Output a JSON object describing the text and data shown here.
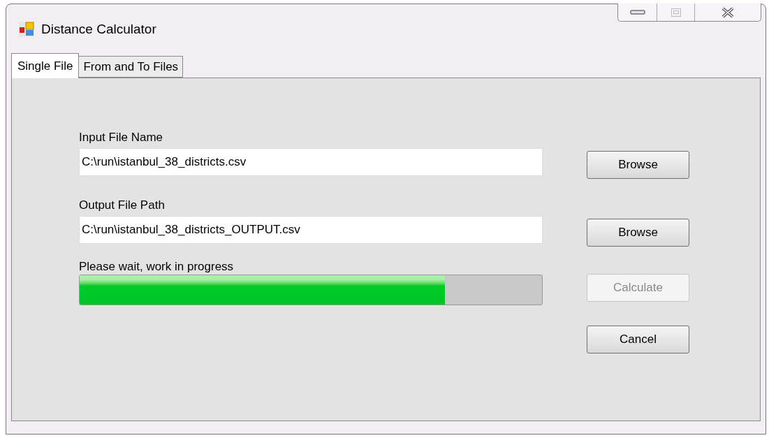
{
  "window": {
    "title": "Distance Calculator"
  },
  "tabs": [
    {
      "label": "Single File",
      "selected": true
    },
    {
      "label": "From and To Files",
      "selected": false
    }
  ],
  "fields": [
    {
      "label": "Input File Name",
      "value": "C:\\run\\istanbul_38_districts.csv",
      "button": {
        "label": "Browse",
        "disabled": false
      }
    },
    {
      "label": "Output File Path",
      "value": "C:\\run\\istanbul_38_districts_OUTPUT.csv",
      "button": {
        "label": "Browse",
        "disabled": false
      }
    }
  ],
  "progress": {
    "label": "Please wait, work in progress",
    "level": 0.79
  },
  "buttons": [
    {
      "label": "Calculate",
      "disabled": true
    },
    {
      "label": "Cancel",
      "disabled": false
    }
  ]
}
